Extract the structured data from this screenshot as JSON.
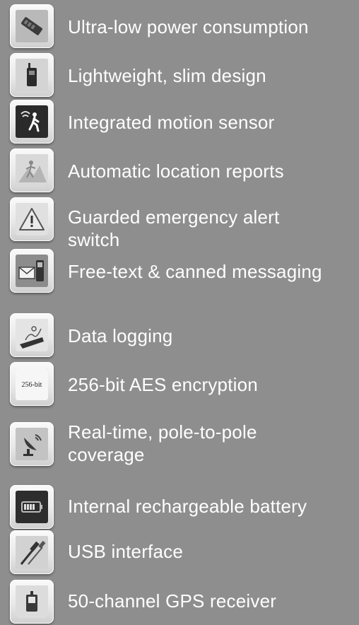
{
  "features": [
    {
      "label": "Ultra-low power  consumption",
      "icon": "battery-pack-icon"
    },
    {
      "label": "Lightweight, slim design",
      "icon": "handheld-device-icon"
    },
    {
      "label": "Integrated motion sensor",
      "icon": "motion-sensor-icon"
    },
    {
      "label": "Automatic location reports",
      "icon": "map-report-icon"
    },
    {
      "label": "Guarded emergency alert\n switch",
      "icon": "warning-triangle-icon"
    },
    {
      "label": "Free-text & canned messaging",
      "icon": "messaging-icon"
    },
    {
      "label": "Data logging",
      "icon": "data-logging-icon"
    },
    {
      "label": "256-bit AES encryption",
      "icon": "encryption-icon",
      "icon_text": "256-bit"
    },
    {
      "label": "Real-time, pole-to-pole\n coverage",
      "icon": "satellite-dish-icon"
    },
    {
      "label": "Internal rechargeable battery",
      "icon": "battery-icon"
    },
    {
      "label": "USB interface",
      "icon": "usb-cable-icon"
    },
    {
      "label": "50-channel GPS receiver",
      "icon": "gps-receiver-icon"
    }
  ],
  "colors": {
    "background": "#8e8e8e",
    "text": "#ffffff",
    "icon_frame": "#ececec"
  }
}
